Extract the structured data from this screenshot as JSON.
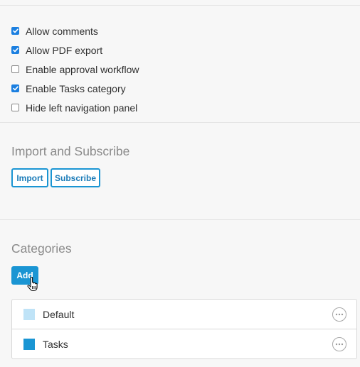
{
  "options": [
    {
      "label": "Allow comments",
      "checked": true
    },
    {
      "label": "Allow PDF export",
      "checked": true
    },
    {
      "label": "Enable approval workflow",
      "checked": false
    },
    {
      "label": "Enable Tasks category",
      "checked": true
    },
    {
      "label": "Hide left navigation panel",
      "checked": false
    }
  ],
  "import_section": {
    "title": "Import and Subscribe",
    "import_label": "Import",
    "subscribe_label": "Subscribe"
  },
  "categories_section": {
    "title": "Categories",
    "add_label": "Add",
    "items": [
      {
        "name": "Default",
        "color": "#bfe3f7"
      },
      {
        "name": "Tasks",
        "color": "#1a95d3"
      }
    ]
  },
  "colors": {
    "accent": "#1a95d3",
    "checkbox_checked": "#1b7fe0"
  },
  "icons": {
    "more": "more-horizontal-icon",
    "cursor": "hand-pointer-cursor-icon",
    "check": "check-icon"
  }
}
